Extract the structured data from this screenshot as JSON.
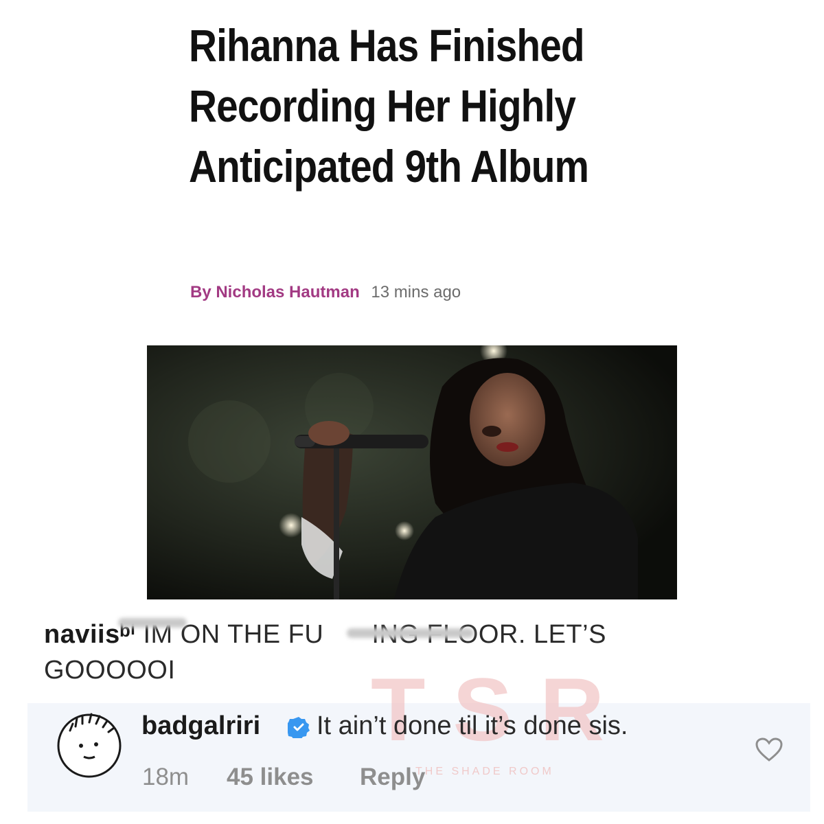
{
  "article": {
    "headline": "Rihanna Has Finished Recording Her Highly Anticipated 9th Album",
    "author": "By Nicholas Hautman",
    "time": "13 mins ago",
    "image_icon": "concert-photo"
  },
  "comments": [
    {
      "username": "naviisᵇⁱ",
      "text_part1": "IM ON THE FU",
      "text_part2": "ING FLOOR. LET’S",
      "text_part3": "GOOOOOI"
    }
  ],
  "reply": {
    "username": "badgalriri",
    "text": "It ain’t done til it’s done sis.",
    "time": "18m",
    "likes": "45 likes",
    "reply_label": "Reply",
    "verified_icon": "verified-badge-icon",
    "like_icon": "heart-icon"
  },
  "watermark": {
    "letters": "TSR",
    "sub": "THE SHADE ROOM"
  },
  "colors": {
    "author": "#a23a83",
    "verified": "#3897f0",
    "reply_bg": "#f3f6fb"
  }
}
